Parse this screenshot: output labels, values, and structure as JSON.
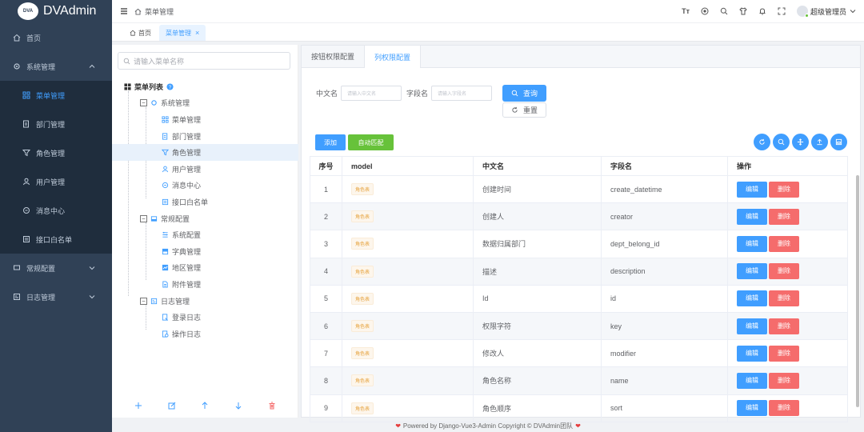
{
  "app": {
    "logo_text": "DVAdmin",
    "logo_badge": "DVA"
  },
  "sidebar": {
    "items": [
      {
        "label": "首页",
        "icon": "home-icon"
      },
      {
        "label": "系统管理",
        "icon": "gear-icon"
      },
      {
        "label": "菜单管理",
        "icon": "grid-icon"
      },
      {
        "label": "部门管理",
        "icon": "document-icon"
      },
      {
        "label": "角色管理",
        "icon": "filter-icon"
      },
      {
        "label": "用户管理",
        "icon": "user-icon"
      },
      {
        "label": "消息中心",
        "icon": "message-icon"
      },
      {
        "label": "接口白名单",
        "icon": "list-icon"
      },
      {
        "label": "常规配置",
        "icon": "monitor-icon"
      },
      {
        "label": "日志管理",
        "icon": "log-icon"
      }
    ]
  },
  "header": {
    "breadcrumb": "菜单管理",
    "user_name": "超级管理员",
    "font_tool": "Tт"
  },
  "tags": [
    {
      "label": "首页"
    },
    {
      "label": "菜单管理"
    }
  ],
  "tree": {
    "search_placeholder": "请输入菜单名称",
    "root": "菜单列表",
    "nodes": [
      "系统管理",
      "菜单管理",
      "部门管理",
      "角色管理",
      "用户管理",
      "消息中心",
      "接口白名单",
      "常规配置",
      "系统配置",
      "字典管理",
      "地区管理",
      "附件管理",
      "日志管理",
      "登录日志",
      "操作日志"
    ]
  },
  "panel": {
    "tabs": [
      {
        "label": "按钮权限配置"
      },
      {
        "label": "列权限配置"
      }
    ],
    "filter": {
      "cn_label": "中文名",
      "cn_placeholder": "请输入中文名",
      "field_label": "字段名",
      "field_placeholder": "请输入字段名",
      "query_label": "查询",
      "reset_label": "重置"
    },
    "add_label": "添加",
    "auto_label": "自动匹配",
    "columns": [
      "序号",
      "model",
      "中文名",
      "字段名",
      "操作"
    ],
    "edit_label": "编辑",
    "delete_label": "删除",
    "rows": [
      {
        "no": "1",
        "model": "角色表",
        "cn": "创建时间",
        "field": "create_datetime"
      },
      {
        "no": "2",
        "model": "角色表",
        "cn": "创建人",
        "field": "creator"
      },
      {
        "no": "3",
        "model": "角色表",
        "cn": "数据归属部门",
        "field": "dept_belong_id"
      },
      {
        "no": "4",
        "model": "角色表",
        "cn": "描述",
        "field": "description"
      },
      {
        "no": "5",
        "model": "角色表",
        "cn": "Id",
        "field": "id"
      },
      {
        "no": "6",
        "model": "角色表",
        "cn": "权限字符",
        "field": "key"
      },
      {
        "no": "7",
        "model": "角色表",
        "cn": "修改人",
        "field": "modifier"
      },
      {
        "no": "8",
        "model": "角色表",
        "cn": "角色名称",
        "field": "name"
      },
      {
        "no": "9",
        "model": "角色表",
        "cn": "角色顺序",
        "field": "sort"
      }
    ]
  },
  "footer": {
    "heart": "❤",
    "text": "Powered by Django-Vue3-Admin Copyright © DVAdmin团队"
  }
}
